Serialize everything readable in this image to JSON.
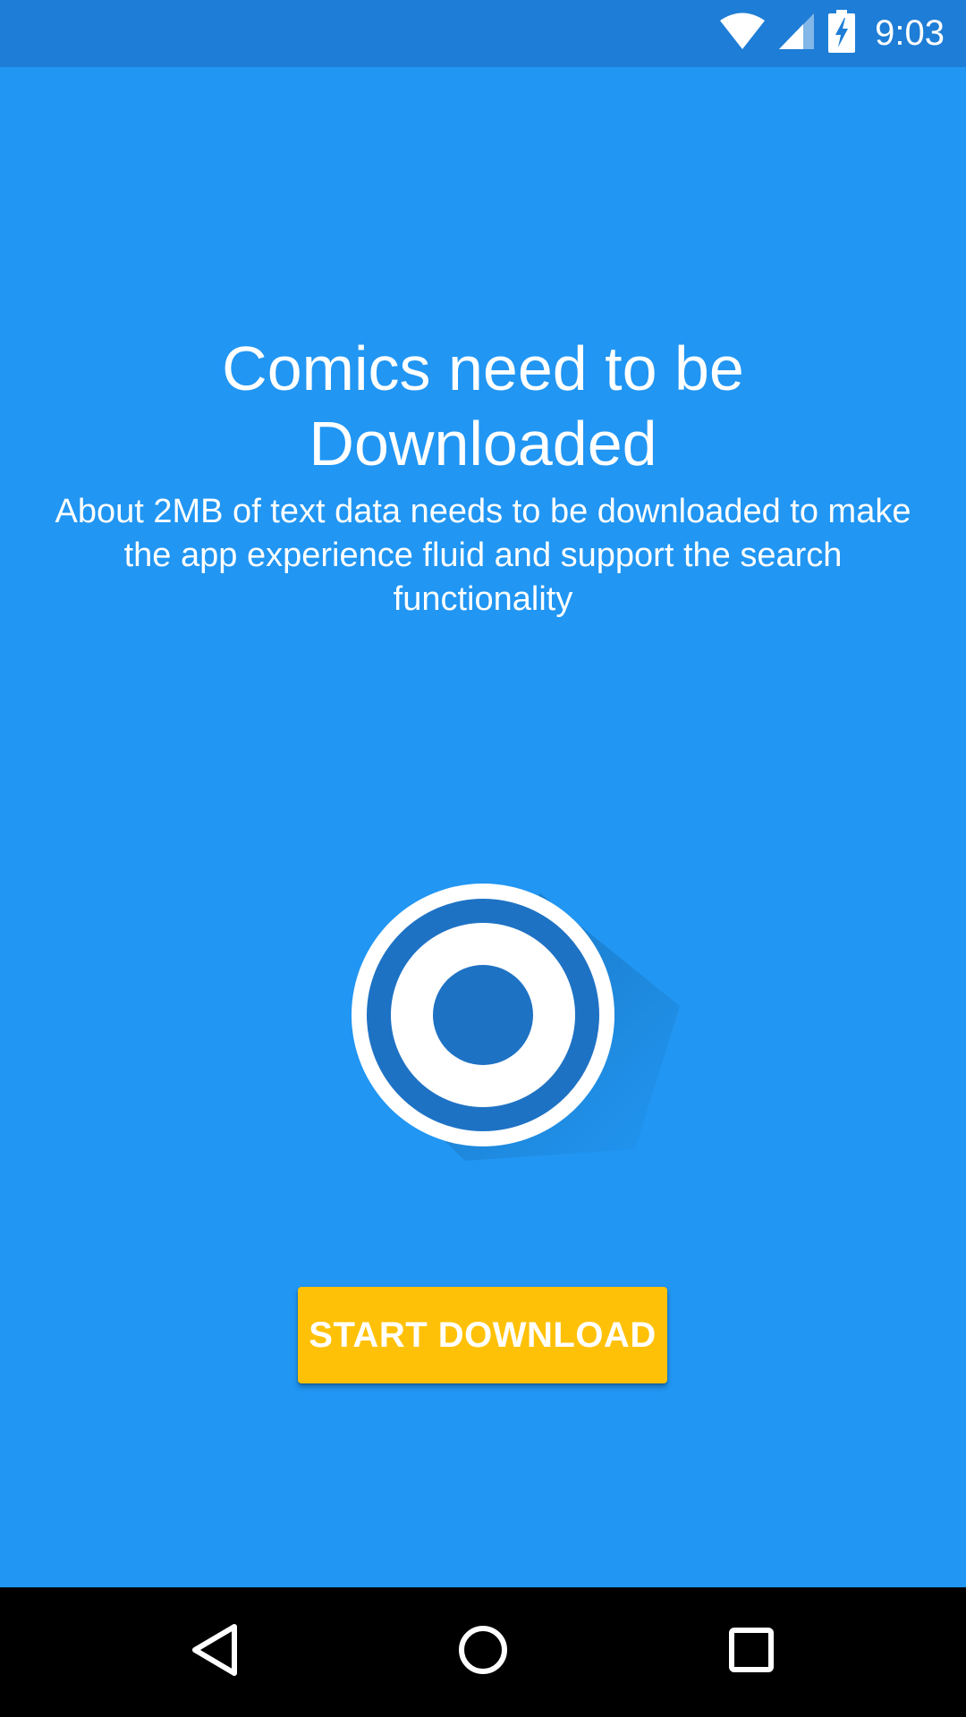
{
  "status_bar": {
    "time": "9:03",
    "icons": [
      "wifi-icon",
      "cell-signal-icon",
      "battery-charging-icon"
    ]
  },
  "main": {
    "title": "Comics need to be Downloaded",
    "subtitle": "About 2MB of text data needs to be downloaded to make the app experience fluid and support the search functionality",
    "logo_icon": "target-logo-icon",
    "download_button_label": "START DOWNLOAD"
  },
  "nav_bar": {
    "buttons": [
      "back-icon",
      "home-icon",
      "recents-icon"
    ]
  },
  "colors": {
    "background": "#2196F3",
    "status_bar": "#1E7DD6",
    "button": "#FFC107",
    "logo_inner": "#1E72C4",
    "text": "#FFFFFF"
  }
}
